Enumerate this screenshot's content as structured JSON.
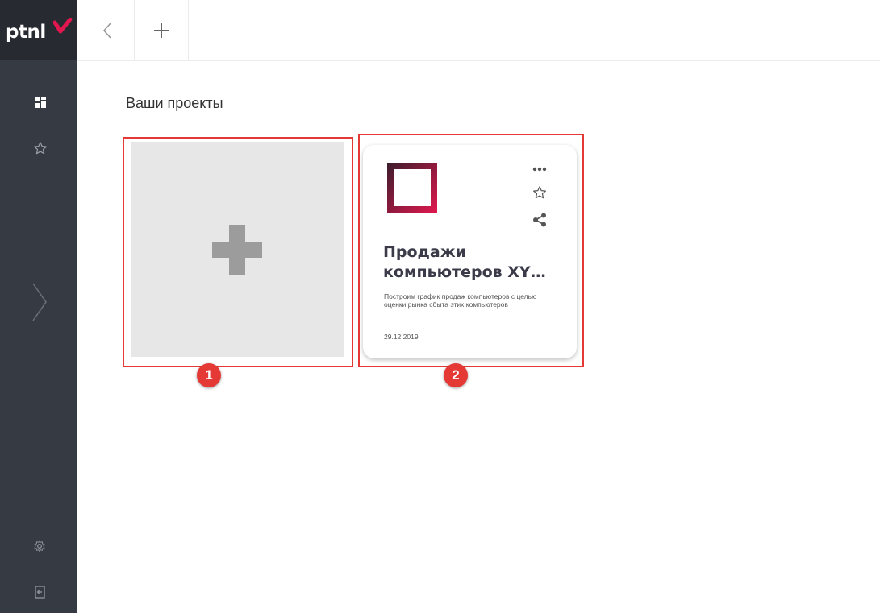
{
  "app": {
    "logo_text": "ptnl"
  },
  "sidebar": {
    "icons": [
      "dashboard-icon",
      "star-icon",
      "chevron-right-icon",
      "settings-icon",
      "logout-icon"
    ]
  },
  "header": {
    "back_icon": "chevron-left-icon",
    "add_icon": "plus-icon"
  },
  "page": {
    "title": "Ваши проекты"
  },
  "projects": [
    {
      "title": "Продажи\nкомпьютеров XY…",
      "description": "Построим график продаж компьютеров с целью оценки рынка сбыта этих компьютеров",
      "date": "29.12.2019",
      "icons": [
        "more-icon",
        "star-icon",
        "share-icon"
      ]
    }
  ],
  "annotations": {
    "badge_1": "1",
    "badge_2": "2",
    "color": "#e53935"
  },
  "colors": {
    "sidebar": "#363a43",
    "logo_bg": "#272a31",
    "accent": "#e0184f",
    "new_tile": "#e7e7e7"
  }
}
